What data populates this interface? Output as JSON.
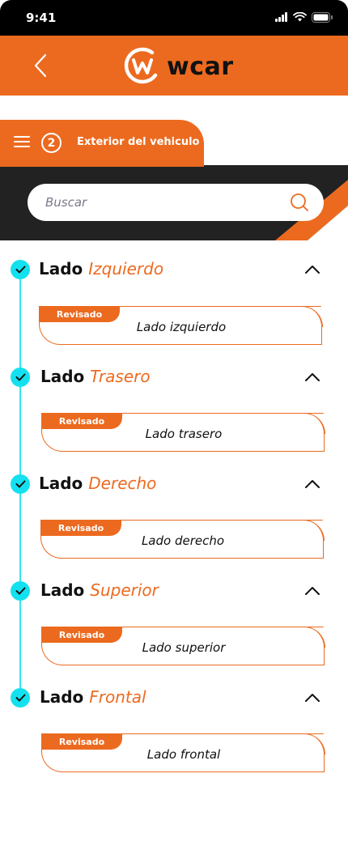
{
  "status_bar": {
    "time": "9:41"
  },
  "header": {
    "brand": "wcar"
  },
  "section": {
    "step": "2",
    "title": "Exterior del vehiculo"
  },
  "search": {
    "placeholder": "Buscar"
  },
  "colors": {
    "accent": "#ec6a1f",
    "dark": "#222222",
    "timeline": "#14e1ef"
  },
  "items": [
    {
      "title_prefix": "Lado",
      "title_accent": "Izquierdo",
      "badge": "Revisado",
      "card_label": "Lado izquierdo"
    },
    {
      "title_prefix": "Lado",
      "title_accent": "Trasero",
      "badge": "Revisado",
      "card_label": "Lado trasero"
    },
    {
      "title_prefix": "Lado",
      "title_accent": "Derecho",
      "badge": "Revisado",
      "card_label": "Lado derecho"
    },
    {
      "title_prefix": "Lado",
      "title_accent": "Superior",
      "badge": "Revisado",
      "card_label": "Lado superior"
    },
    {
      "title_prefix": "Lado",
      "title_accent": "Frontal",
      "badge": "Revisado",
      "card_label": "Lado frontal"
    }
  ]
}
